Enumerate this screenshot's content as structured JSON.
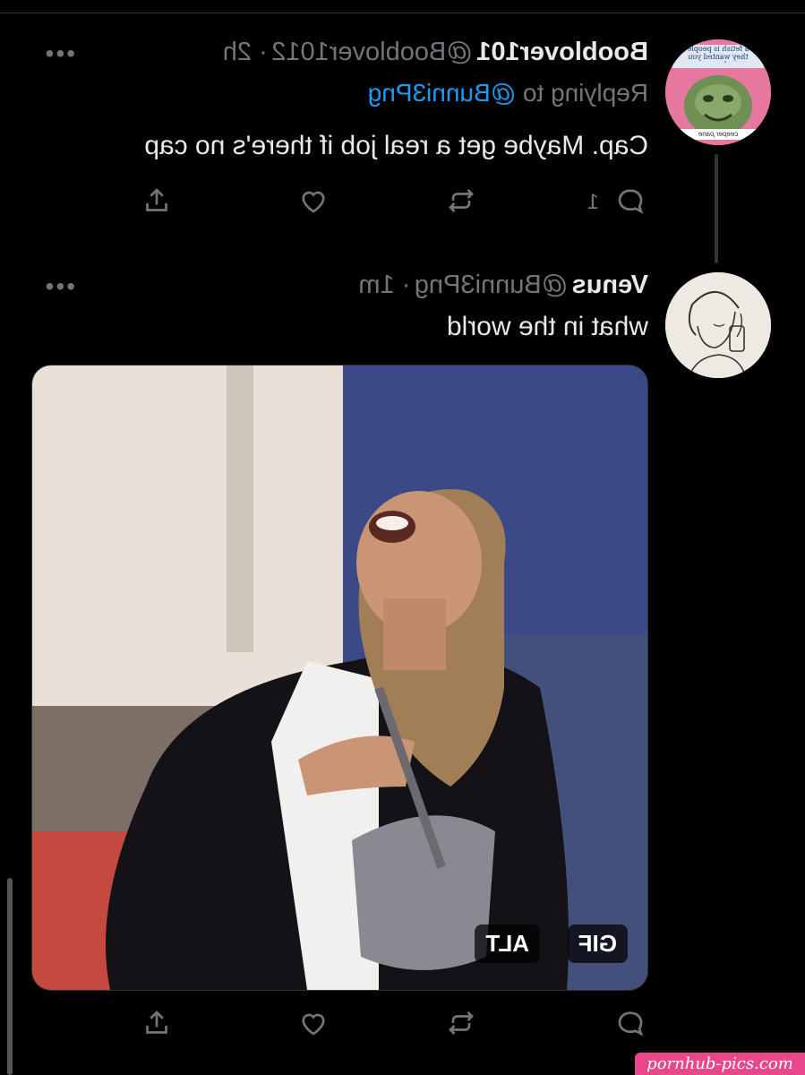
{
  "tweet1": {
    "display_name": "Booblover101",
    "handle": "@Booblover1012",
    "time": "· 2h",
    "replying_prefix": "Replying to",
    "replying_to": "@Bunni3Png",
    "text": "Cap. Maybe get a real job if there's no cap",
    "reply_count": "1",
    "more_label": "•••"
  },
  "tweet2": {
    "display_name": "Venus",
    "handle": "@Bunni3Png",
    "time": "· 1m",
    "text": "what in the world",
    "more_label": "•••",
    "media": {
      "gif_badge": "GIF",
      "alt_badge": "ALT"
    }
  },
  "avatar1_text": {
    "top": "a fetish is people they wanted you here",
    "bottom": "ceeper pane"
  },
  "watermark": "pornhub-pics.com",
  "colors": {
    "background": "#000000",
    "text": "#e7e9ea",
    "muted": "#71767b",
    "link": "#1d9bf0",
    "watermark": "#e8478b"
  },
  "icons": [
    "reply-icon",
    "retweet-icon",
    "like-icon",
    "share-icon",
    "more-icon"
  ]
}
